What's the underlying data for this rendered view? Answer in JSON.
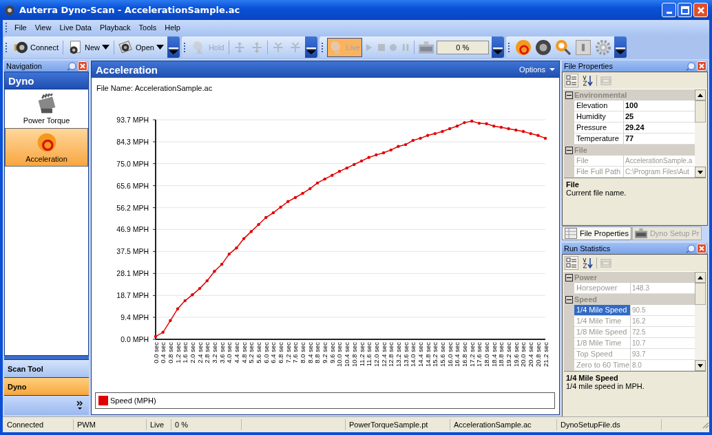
{
  "window": {
    "title": "Auterra Dyno-Scan - AccelerationSample.ac"
  },
  "menu": [
    "File",
    "View",
    "Live Data",
    "Playback",
    "Tools",
    "Help"
  ],
  "toolbars": [
    {
      "items": [
        {
          "kind": "button",
          "label": "Connect",
          "disabled": false
        },
        {
          "kind": "separator"
        },
        {
          "kind": "button",
          "label": "New",
          "dropdown": true,
          "disabled": false
        },
        {
          "kind": "separator"
        },
        {
          "kind": "button",
          "label": "Open",
          "dropdown": true,
          "disabled": false
        }
      ]
    },
    {
      "items": [
        {
          "kind": "button",
          "label": "Hold",
          "disabled": true
        },
        {
          "kind": "separator"
        },
        {
          "kind": "button",
          "disabled": true
        },
        {
          "kind": "button",
          "disabled": true
        },
        {
          "kind": "separator"
        },
        {
          "kind": "button",
          "disabled": true
        },
        {
          "kind": "button",
          "disabled": true
        }
      ]
    },
    {
      "items": [
        {
          "kind": "button",
          "label": "Live",
          "disabled": true,
          "selected": true
        },
        {
          "kind": "button",
          "disabled": true
        },
        {
          "kind": "button",
          "disabled": true
        },
        {
          "kind": "button",
          "disabled": true
        },
        {
          "kind": "button",
          "disabled": true
        },
        {
          "kind": "separator"
        },
        {
          "kind": "button",
          "disabled": true
        },
        {
          "kind": "progress",
          "label": "0 %",
          "level": 0
        }
      ]
    },
    {
      "items": [
        {
          "kind": "button",
          "disabled": false
        },
        {
          "kind": "button",
          "disabled": false
        },
        {
          "kind": "button",
          "disabled": false
        },
        {
          "kind": "button",
          "disabled": false
        },
        {
          "kind": "button",
          "disabled": false
        }
      ]
    }
  ],
  "navigation": {
    "title": "Navigation",
    "header": "Dyno",
    "items": [
      {
        "label": "Power Torque",
        "selected": false
      },
      {
        "label": "Acceleration",
        "selected": true
      }
    ],
    "groups": [
      {
        "label": "Scan Tool",
        "selected": false
      },
      {
        "label": "Dyno",
        "selected": true
      }
    ]
  },
  "document": {
    "title": "Acceleration",
    "options": "Options",
    "file_name": "File Name: AccelerationSample.ac",
    "chart_data": {
      "type": "line",
      "grid": true,
      "categories": [
        "0.0 sec",
        "0.4 sec",
        "0.8 sec",
        "1.2 sec",
        "1.6 sec",
        "2.0 sec",
        "2.4 sec",
        "2.8 sec",
        "3.2 sec",
        "3.6 sec",
        "4.0 sec",
        "4.4 sec",
        "4.8 sec",
        "5.2 sec",
        "5.6 sec",
        "6.0 sec",
        "6.4 sec",
        "6.8 sec",
        "7.2 sec",
        "7.6 sec",
        "8.0 sec",
        "8.4 sec",
        "8.8 sec",
        "9.2 sec",
        "9.6 sec",
        "10.0 sec",
        "10.4 sec",
        "10.8 sec",
        "11.2 sec",
        "11.6 sec",
        "12.0 sec",
        "12.4 sec",
        "12.8 sec",
        "13.2 sec",
        "13.6 sec",
        "14.0 sec",
        "14.4 sec",
        "14.8 sec",
        "15.2 sec",
        "15.6 sec",
        "16.0 sec",
        "16.4 sec",
        "16.8 sec",
        "17.2 sec",
        "17.6 sec",
        "18.0 sec",
        "18.4 sec",
        "18.8 sec",
        "19.2 sec",
        "19.6 sec",
        "20.0 sec",
        "20.4 sec",
        "20.8 sec",
        "21.2 sec"
      ],
      "series": [
        {
          "name": "Speed (MPH)",
          "color": "#e00000",
          "marker": true,
          "values": [
            1.2,
            3,
            8,
            13,
            16.5,
            19,
            21.7,
            25,
            29,
            32,
            36.4,
            39,
            43,
            46,
            49,
            52,
            54,
            56.4,
            58.8,
            60.5,
            62.3,
            64.3,
            66.7,
            68.4,
            70,
            71.7,
            73.1,
            74.6,
            76.1,
            77.6,
            78.7,
            79.6,
            80.8,
            82.3,
            83.1,
            84.9,
            85.8,
            87,
            87.8,
            88.7,
            89.9,
            91,
            92.5,
            93.1,
            92.2,
            92,
            91,
            90.5,
            89.9,
            89.3,
            88.7,
            87.8,
            87,
            85.8
          ]
        }
      ],
      "ylim": [
        0,
        93.7
      ],
      "yticks": [
        {
          "value": 0,
          "label": "0.0 MPH"
        },
        {
          "value": 9.4,
          "label": "9.4 MPH"
        },
        {
          "value": 18.7,
          "label": "18.7 MPH"
        },
        {
          "value": 28.1,
          "label": "28.1 MPH"
        },
        {
          "value": 37.5,
          "label": "37.5 MPH"
        },
        {
          "value": 46.9,
          "label": "46.9 MPH"
        },
        {
          "value": 56.2,
          "label": "56.2 MPH"
        },
        {
          "value": 65.6,
          "label": "65.6 MPH"
        },
        {
          "value": 75,
          "label": "75.0 MPH"
        },
        {
          "value": 84.3,
          "label": "84.3 MPH"
        },
        {
          "value": 93.7,
          "label": "93.7 MPH"
        }
      ]
    }
  },
  "file_properties": {
    "title": "File Properties",
    "categories": [
      {
        "name": "Environmental",
        "expanded": true,
        "rows": [
          {
            "name": "Elevation",
            "value": "100",
            "readonly": false,
            "selected": false
          },
          {
            "name": "Humidity",
            "value": "25",
            "readonly": false,
            "selected": false
          },
          {
            "name": "Pressure",
            "value": "29.24",
            "readonly": false,
            "selected": false
          },
          {
            "name": "Temperature",
            "value": "77",
            "readonly": false,
            "selected": false
          }
        ]
      },
      {
        "name": "File",
        "expanded": true,
        "rows": [
          {
            "name": "File",
            "value": "AccelerationSample.a",
            "readonly": true,
            "selected": false
          },
          {
            "name": "File Full Path",
            "value": "C:\\Program Files\\Aut",
            "readonly": true,
            "selected": false
          }
        ]
      }
    ],
    "description": {
      "title": "File",
      "text": "Current file name."
    },
    "tabs": [
      {
        "label": "File Properties",
        "selected": true
      },
      {
        "label": "Dyno Setup Pr",
        "selected": false
      }
    ]
  },
  "run_statistics": {
    "title": "Run Statistics",
    "categories": [
      {
        "name": "Power",
        "expanded": true,
        "rows": [
          {
            "name": "Horsepower",
            "value": "148.3",
            "readonly": true,
            "selected": false
          }
        ]
      },
      {
        "name": "Speed",
        "expanded": true,
        "rows": [
          {
            "name": "1/4 Mile Speed",
            "value": "90.5",
            "readonly": true,
            "selected": true
          },
          {
            "name": "1/4 Mile Time",
            "value": "16.2",
            "readonly": true,
            "selected": false
          },
          {
            "name": "1/8 Mile Speed",
            "value": "72.5",
            "readonly": true,
            "selected": false
          },
          {
            "name": "1/8 Mile Time",
            "value": "10.7",
            "readonly": true,
            "selected": false
          },
          {
            "name": "Top Speed",
            "value": "93.7",
            "readonly": true,
            "selected": false
          },
          {
            "name": "Zero to 60 Time",
            "value": "8.0",
            "readonly": true,
            "selected": false
          }
        ]
      }
    ],
    "description": {
      "title": "1/4 Mile Speed",
      "text": "1/4 mile speed in MPH."
    }
  },
  "status_bar": [
    "Connected",
    "PWM",
    "Live",
    "0 %",
    "PowerTorqueSample.pt",
    "AccelerationSample.ac",
    "DynoSetupFile.ds"
  ]
}
